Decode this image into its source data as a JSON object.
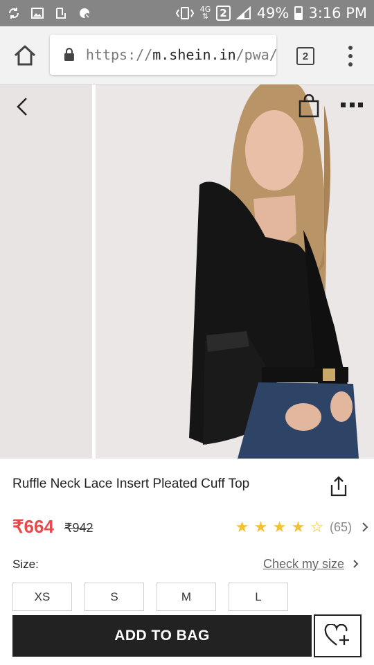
{
  "status_bar": {
    "network": "4G",
    "sim": "2",
    "battery": "49%",
    "time": "3:16 PM"
  },
  "browser": {
    "url_scheme": "https://",
    "url_host": "m.shein.in",
    "url_path": "/pwa/",
    "tab_count": "2"
  },
  "product": {
    "title": "Ruffle Neck Lace Insert Pleated Cuff Top",
    "price": "₹664",
    "original_price": "₹942",
    "rating_stars": 4.5,
    "review_count": "(65)"
  },
  "size": {
    "label": "Size:",
    "check_link": "Check my size",
    "options": [
      "XS",
      "S",
      "M",
      "L"
    ]
  },
  "actions": {
    "add_to_bag": "ADD TO BAG"
  },
  "colors": {
    "price": "#e84a4a",
    "star": "#f4c034",
    "cta": "#222222",
    "status_bar": "#858585"
  }
}
